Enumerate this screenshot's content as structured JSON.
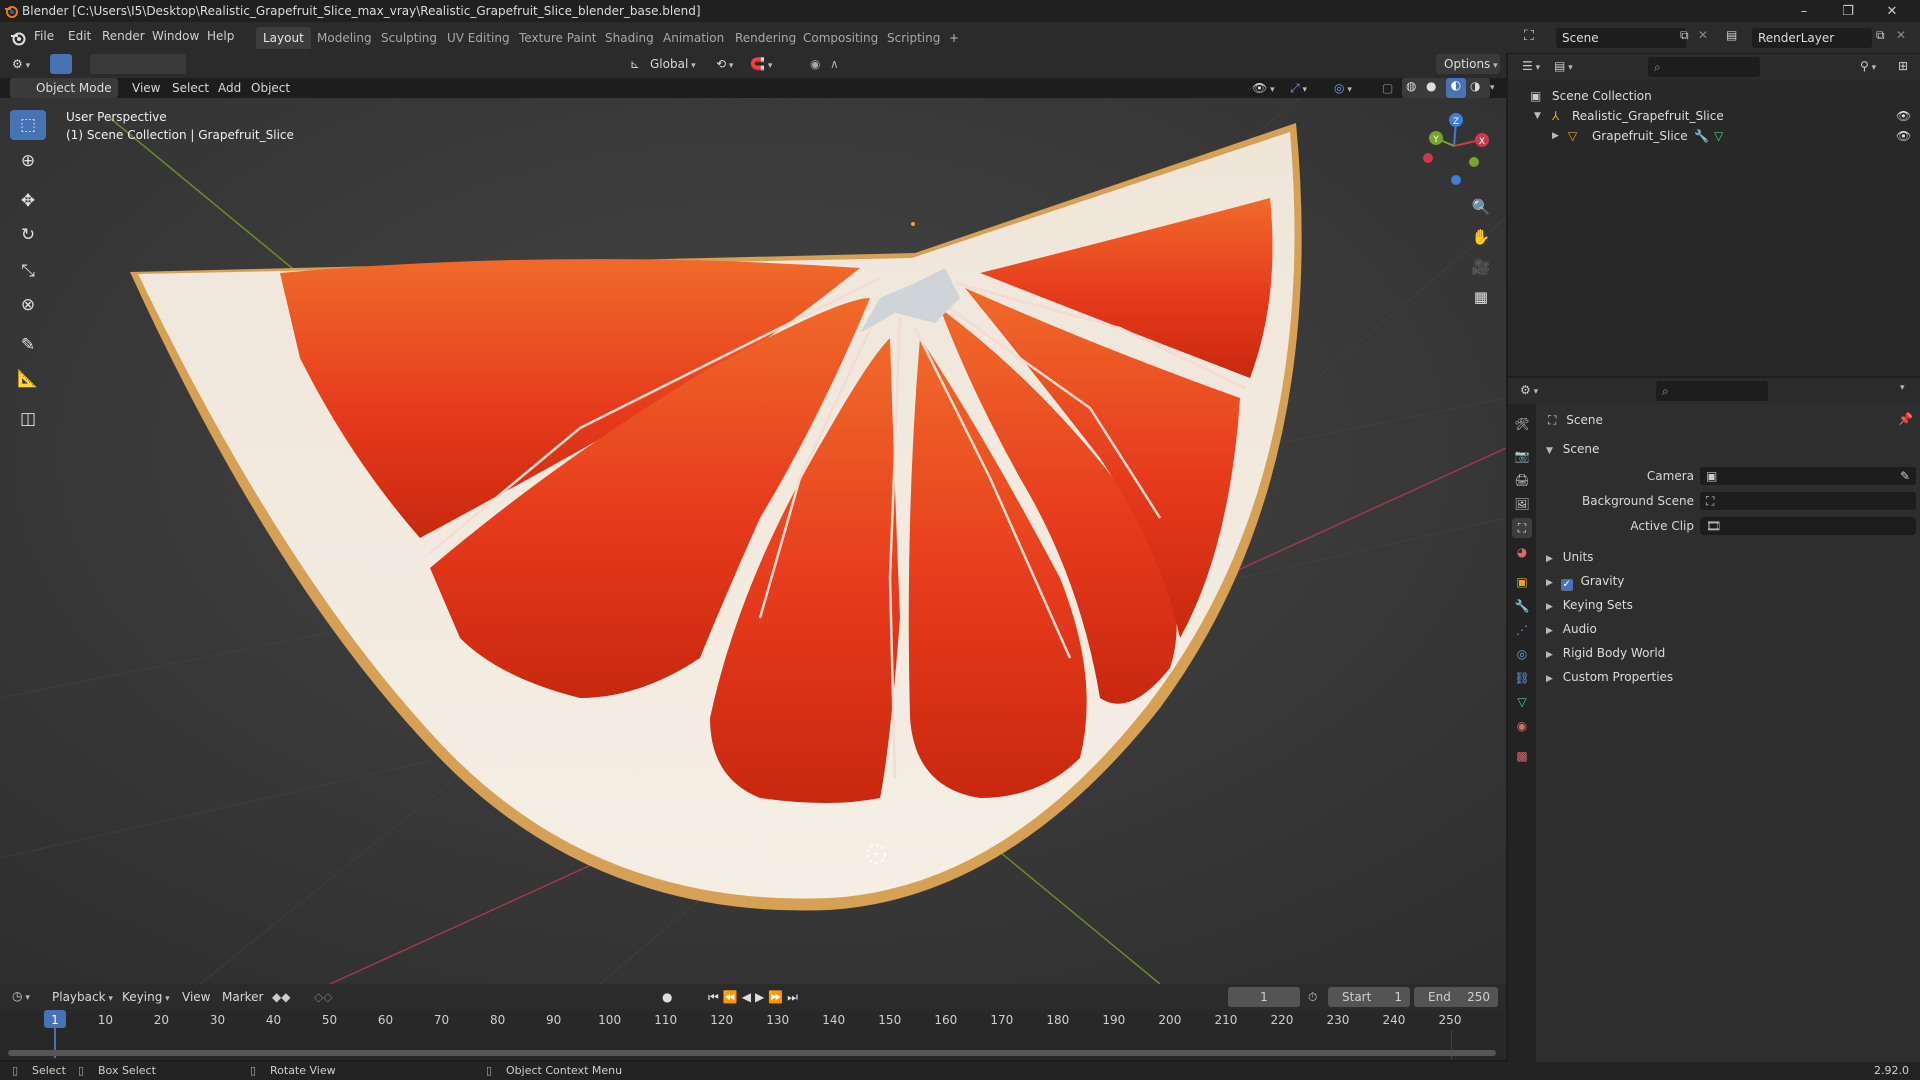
{
  "window": {
    "title": "Blender [C:\\Users\\I5\\Desktop\\Realistic_Grapefruit_Slice_max_vray\\Realistic_Grapefruit_Slice_blender_base.blend]",
    "minimize": "–",
    "maximize": "❐",
    "close": "✕"
  },
  "menu": [
    "File",
    "Edit",
    "Render",
    "Window",
    "Help"
  ],
  "workspaces": [
    "Layout",
    "Modeling",
    "Sculpting",
    "UV Editing",
    "Texture Paint",
    "Shading",
    "Animation",
    "Rendering",
    "Compositing",
    "Scripting"
  ],
  "workspace_add": "+",
  "scene_selector": {
    "scene": "Scene",
    "view_layer": "RenderLayer"
  },
  "tool_header": {
    "orientation": "Global",
    "options": "Options"
  },
  "viewport_header": {
    "mode": "Object Mode",
    "menus": [
      "View",
      "Select",
      "Add",
      "Object"
    ]
  },
  "viewport": {
    "perspective_label": "User Perspective",
    "collection_label": "(1) Scene Collection | Grapefruit_Slice",
    "gizmo": {
      "x": "X",
      "y": "Y",
      "z": "Z"
    }
  },
  "tools": [
    {
      "name": "select-box",
      "icon": "⬚"
    },
    {
      "name": "cursor",
      "icon": "⊕"
    },
    {
      "name": "move",
      "icon": "✥"
    },
    {
      "name": "rotate",
      "icon": "↻"
    },
    {
      "name": "scale",
      "icon": "⤡"
    },
    {
      "name": "transform",
      "icon": "⊗"
    },
    {
      "name": "annotate",
      "icon": "✎"
    },
    {
      "name": "measure",
      "icon": "📐"
    },
    {
      "name": "add-cube",
      "icon": "◫"
    }
  ],
  "outliner": {
    "root": "Scene Collection",
    "items": [
      {
        "label": "Realistic_Grapefruit_Slice",
        "depth": 1
      },
      {
        "label": "Grapefruit_Slice",
        "depth": 2
      }
    ]
  },
  "properties": {
    "context": "Scene",
    "section": "Scene",
    "fields": [
      {
        "label": "Camera"
      },
      {
        "label": "Background Scene"
      },
      {
        "label": "Active Clip"
      }
    ],
    "panels": [
      {
        "label": "Units",
        "checkbox": false
      },
      {
        "label": "Gravity",
        "checkbox": true
      },
      {
        "label": "Keying Sets",
        "checkbox": false
      },
      {
        "label": "Audio",
        "checkbox": false
      },
      {
        "label": "Rigid Body World",
        "checkbox": false
      },
      {
        "label": "Custom Properties",
        "checkbox": false
      }
    ]
  },
  "timeline": {
    "menus": [
      "Playback",
      "Keying",
      "View",
      "Marker"
    ],
    "current_frame": "1",
    "start_label": "Start",
    "start": "1",
    "end_label": "End",
    "end": "250",
    "ticks": [
      "1",
      "10",
      "20",
      "30",
      "40",
      "50",
      "60",
      "70",
      "80",
      "90",
      "100",
      "110",
      "120",
      "130",
      "140",
      "150",
      "160",
      "170",
      "180",
      "190",
      "200",
      "210",
      "220",
      "230",
      "240",
      "250"
    ]
  },
  "statusbar": {
    "select": "Select",
    "box_select": "Box Select",
    "rotate_view": "Rotate View",
    "context_menu": "Object Context Menu",
    "version": "2.92.0"
  },
  "colors": {
    "accent": "#4772b3",
    "viewport_bg": "#393939",
    "x_axis": "#c93b4c",
    "y_axis": "#7aa32d",
    "z_axis": "#3b7fd9",
    "flesh": "#e8421c",
    "pith": "#f2e9de"
  }
}
